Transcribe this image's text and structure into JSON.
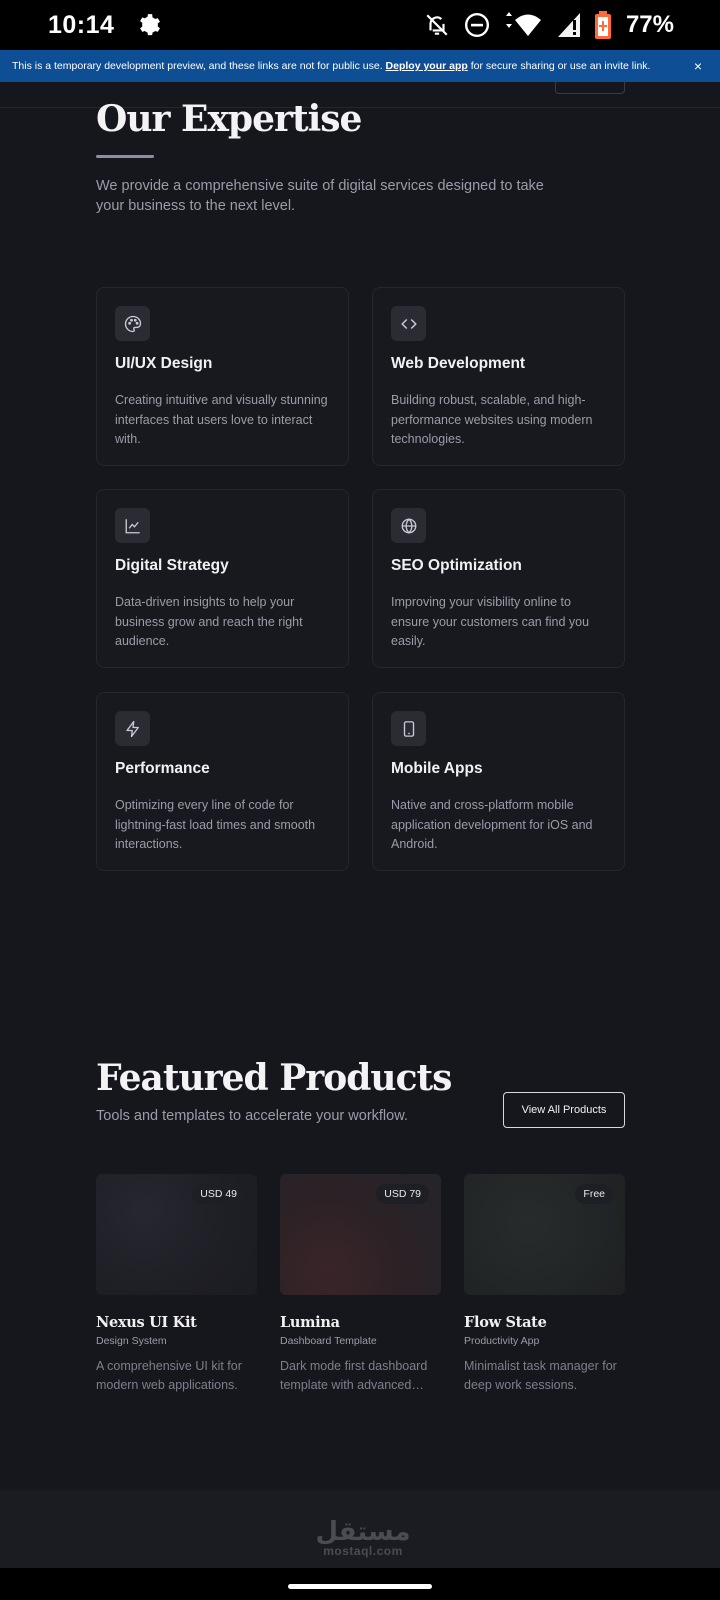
{
  "status_bar": {
    "time": "10:14",
    "battery": "77%",
    "icons": [
      "settings-icon",
      "notifications-off-icon",
      "do-not-disturb-icon",
      "data-arrows-icon",
      "wifi-icon",
      "signal-icon",
      "battery-icon"
    ]
  },
  "banner": {
    "text_before": "This is a temporary development preview, and these links are not for public use. ",
    "link": "Deploy your app",
    "text_after": " for secure sharing or use an invite link.",
    "close": "×",
    "color": "#0d4e94"
  },
  "expertise": {
    "title": "Our Expertise",
    "subtitle": "We provide a comprehensive suite of digital services designed to take your business to the next level.",
    "services": [
      {
        "icon": "palette-icon",
        "title": "UI/UX Design",
        "description": "Creating intuitive and visually stunning interfaces that users love to interact with."
      },
      {
        "icon": "code-icon",
        "title": "Web Development",
        "description": "Building robust, scalable, and high-performance websites using modern technologies."
      },
      {
        "icon": "chart-line-icon",
        "title": "Digital Strategy",
        "description": "Data-driven insights to help your business grow and reach the right audience."
      },
      {
        "icon": "globe-icon",
        "title": "SEO Optimization",
        "description": "Improving your visibility online to ensure your customers can find you easily."
      },
      {
        "icon": "lightning-icon",
        "title": "Performance",
        "description": "Optimizing every line of code for lightning-fast load times and smooth interactions."
      },
      {
        "icon": "smartphone-icon",
        "title": "Mobile Apps",
        "description": "Native and cross-platform mobile application development for iOS and Android."
      }
    ]
  },
  "featured": {
    "title": "Featured Products",
    "subtitle": "Tools and templates to accelerate your workflow.",
    "view_all": "View All Products",
    "products": [
      {
        "name": "Nexus UI Kit",
        "category": "Design System",
        "price": "USD 49",
        "description": "A comprehensive UI kit for modern web applications."
      },
      {
        "name": "Lumina",
        "category": "Dashboard Template",
        "price": "USD 79",
        "description": "Dark mode first dashboard template with advanced…"
      },
      {
        "name": "Flow State",
        "category": "Productivity App",
        "price": "Free",
        "description": "Minimalist task manager for deep work sessions."
      }
    ]
  },
  "watermark": {
    "arabic": "مستقل",
    "latin": "mostaql.com"
  }
}
